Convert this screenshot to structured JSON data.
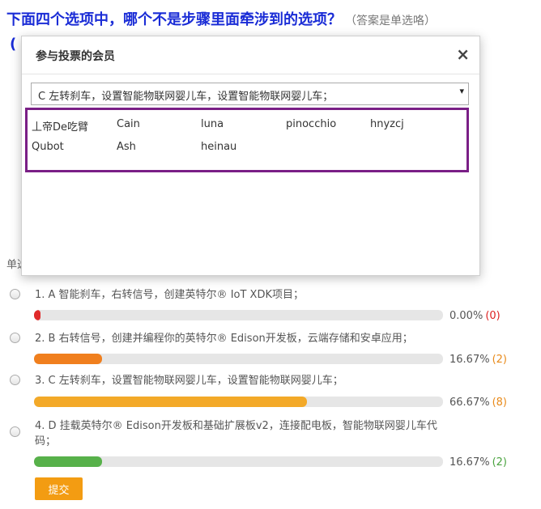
{
  "question": {
    "text": "下面四个选项中，哪个不是步骤里面牵涉到的选项？",
    "hint": "（答案是单选咯）",
    "paren_fragment": "("
  },
  "type_label_fragment": "单选",
  "options": [
    {
      "label": "1.  A 智能刹车，右转信号，创建英特尔® IoT XDK项目；",
      "percent": "0.00%",
      "count": "(0)",
      "fraction": 0.0,
      "color": "#e02a2a"
    },
    {
      "label": "2.  B 右转信号，创建并编程你的英特尔® Edison开发板，云端存储和安卓应用；",
      "percent": "16.67%",
      "count": "(2)",
      "fraction": 0.1667,
      "color": "#f07f1e"
    },
    {
      "label": "3.  C 左转刹车，设置智能物联网婴儿车，设置智能物联网婴儿车；",
      "percent": "66.67%",
      "count": "(8)",
      "fraction": 0.6667,
      "color": "#f3a928"
    },
    {
      "label": "4.  D 挂载英特尔® Edison开发板和基础扩展板v2，连接配电板，智能物联网婴儿车代码；",
      "percent": "16.67%",
      "count": "(2)",
      "fraction": 0.1667,
      "color": "#57b14a"
    }
  ],
  "submit_label": "提交",
  "modal": {
    "title": "参与投票的会员",
    "close_symbol": "×",
    "selected_option": "C 左转刹车，设置智能物联网婴儿车，设置智能物联网婴儿车；",
    "dropdown_arrow": "▾",
    "members": [
      "丄帝De吃臂",
      "Cain",
      "luna",
      "pinocchio",
      "hnyzcj",
      "Qubot",
      "Ash",
      "heinau"
    ]
  }
}
